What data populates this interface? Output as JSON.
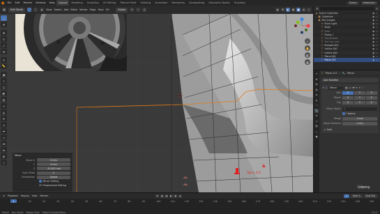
{
  "app": {
    "menus": [
      "File",
      "Edit",
      "Render",
      "Window",
      "Help"
    ],
    "workspaces": [
      "Layout",
      "Modeling",
      "Sculpting",
      "UV Editing",
      "Texture Paint",
      "Shading",
      "Animation",
      "Rendering",
      "Compositing",
      "Geometry Nodes",
      "Scripting"
    ],
    "active_workspace": "Layout",
    "scene": "Scene",
    "view_layer": "ViewLayer"
  },
  "viewport_header": {
    "mode": "Edit Mode",
    "menus": [
      "View",
      "Select",
      "Add",
      "Mesh",
      "Vertex",
      "Edge",
      "Face",
      "UV"
    ],
    "orientation": "Global",
    "options_label": "Options"
  },
  "toolbar": {
    "tools": [
      "cursor-select",
      "move",
      "rotate",
      "scale",
      "transform",
      "annotate",
      "measure",
      "add-cube",
      "extrude",
      "inset",
      "bevel",
      "loop-cut",
      "knife",
      "poly-build",
      "spin",
      "smooth",
      "edge-slide",
      "shrink-fatten",
      "shear",
      "rip"
    ]
  },
  "operator_panel": {
    "title": "Move",
    "props": [
      {
        "label": "Move X",
        "value": "0 mm"
      },
      {
        "label": "Y",
        "value": "0 mm"
      },
      {
        "label": "Z",
        "value": "-31.043 mm"
      },
      {
        "label": "Axis Ortho",
        "value": "X"
      },
      {
        "label": "Orientation",
        "value": "Global"
      }
    ],
    "checks": [
      {
        "label": "Mirror Editing",
        "checked": true
      },
      {
        "label": "Proportional Editing",
        "checked": false
      }
    ]
  },
  "viewport_overlay": {
    "annotation_text": "3pt x 4.5"
  },
  "outliner": {
    "rows": [
      {
        "name": "Scene Collection",
        "icon": "◈",
        "selected": false,
        "dim": false,
        "indent": 0
      },
      {
        "name": "Collection",
        "icon": "▣",
        "selected": false,
        "dim": false,
        "indent": 1
      },
      {
        "name": "Ref_Images",
        "icon": "▣",
        "selected": false,
        "dim": false,
        "indent": 1
      },
      {
        "name": "Front Light",
        "icon": "☀",
        "selected": false,
        "dim": false,
        "indent": 2
      },
      {
        "name": "Body",
        "icon": "▽",
        "selected": false,
        "dim": false,
        "indent": 2
      },
      {
        "name": "Door",
        "icon": "▽",
        "selected": false,
        "dim": true,
        "indent": 2
      },
      {
        "name": "Ramp.1",
        "icon": "▽",
        "selected": false,
        "dim": false,
        "indent": 2
      },
      {
        "name": "Placeholder",
        "icon": "▽",
        "selected": false,
        "dim": true,
        "indent": 2
      },
      {
        "name": "Ref. top view",
        "icon": "▽",
        "selected": false,
        "dim": true,
        "indent": 2
      },
      {
        "name": "Bumper.001",
        "icon": "▽",
        "selected": false,
        "dim": false,
        "indent": 2
      },
      {
        "name": "Lattice.001",
        "icon": "▽",
        "selected": false,
        "dim": false,
        "indent": 2
      },
      {
        "name": "Lattice.002",
        "icon": "▽",
        "selected": false,
        "dim": false,
        "indent": 2
      },
      {
        "name": "Plane.001",
        "icon": "▽",
        "selected": false,
        "dim": false,
        "indent": 2
      },
      {
        "name": "Plane.111",
        "icon": "▽",
        "selected": true,
        "dim": false,
        "indent": 2
      }
    ]
  },
  "properties": {
    "object_name": "Plane.111",
    "modifier_context": "Mirror",
    "add_modifier_label": "Add Modifier",
    "modifier": {
      "name": "Mirror",
      "axis_label": "Axis",
      "bisect_label": "Bisect",
      "flip_label": "Flip",
      "axes": [
        "X",
        "Y",
        "Z"
      ],
      "axis_on": [
        true,
        false,
        false
      ],
      "bisect_on": [
        false,
        false,
        false
      ],
      "flip_on": [
        false,
        false,
        false
      ],
      "mirror_object_label": "Mirror Object",
      "clipping_label": "Clipping",
      "merge_label": "Merge",
      "merge_value": "1 mm",
      "bisect_distance_label": "Bisect Distance",
      "bisect_distance_value": "1 mm",
      "data_label": "Data"
    }
  },
  "timeline": {
    "menus": [
      "Playback",
      "Keying",
      "View",
      "Marker"
    ],
    "current_frame": "1",
    "start_label": "Start",
    "start": "1",
    "end_label": "End",
    "end": "250",
    "ruler": [
      "0",
      "10",
      "20",
      "30",
      "40",
      "50",
      "60",
      "70",
      "80",
      "90",
      "100",
      "110",
      "120",
      "130",
      "140",
      "150",
      "160",
      "170",
      "180",
      "190",
      "200",
      "210",
      "220",
      "230",
      "240",
      "250"
    ]
  },
  "statusbar": {
    "items": [
      "Select",
      "Box Select",
      "Rotate View",
      "Object Context Menu"
    ],
    "version": "3.2.1"
  },
  "watermark": "Udemy",
  "colors": {
    "accent": "#4772b3",
    "orange_line": "#e07a18",
    "gizmo_x": "#e5474f",
    "gizmo_y": "#8bbd27",
    "gizmo_z": "#3f87dc"
  }
}
